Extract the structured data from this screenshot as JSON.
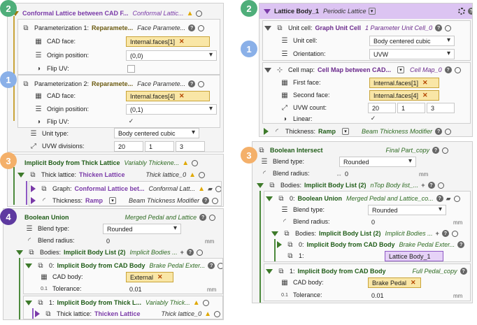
{
  "colors": {
    "badge_green": "#4fae7a",
    "badge_blue": "#8ab0e8",
    "badge_orange": "#f4b06a",
    "badge_purple": "#5e3aa0",
    "chip_gold": "#f9e6a6",
    "chip_purple": "#e6d2f7"
  },
  "badges": {
    "b2a": "2",
    "b1a": "1",
    "b3a": "3",
    "b4": "4",
    "b2b": "2",
    "b1b": "1",
    "b3b": "3"
  },
  "lattice_panel": {
    "title": "Conformal Lattice between CAD F...",
    "title_type": "Conformal Lattic...",
    "param1": {
      "title": "Parameterization 1:",
      "name": "Reparamete...",
      "type": "Face Paramete...",
      "cad_face_label": "CAD face:",
      "cad_face_value": "Internal.faces[1]",
      "origin_label": "Origin position:",
      "origin_value": "(0,0)",
      "flip_label": "Flip UV:"
    },
    "param2": {
      "title": "Parameterization 2:",
      "name": "Reparamete...",
      "type": "Face Paramete...",
      "cad_face_label": "CAD face:",
      "cad_face_value": "Internal.faces[4]",
      "origin_label": "Origin position:",
      "origin_value": "(0,1)",
      "flip_label": "Flip UV:",
      "flip_check": "✓"
    },
    "unit_type_label": "Unit type:",
    "unit_type_value": "Body centered cubic",
    "uvw_label": "UVW divisions:",
    "uvw_values": [
      "20",
      "1",
      "3"
    ]
  },
  "thick_panel": {
    "title": "Implicit Body from Thick Lattice",
    "title_type": "Variably Thickene...",
    "thick_label": "Thick lattice:",
    "thick_name": "Thicken Lattice",
    "thick_type": "Thick lattice_0",
    "graph_label": "Graph:",
    "graph_name": "Conformal Lattice bet...",
    "graph_type": "Conformal Latt...",
    "thickness_label": "Thickness:",
    "thickness_name": "Ramp",
    "thickness_type": "Beam Thickness Modifier"
  },
  "union_panel": {
    "title": "Boolean Union",
    "title_type": "Merged Pedal and Lattice",
    "blend_type_label": "Blend type:",
    "blend_type_value": "Rounded",
    "blend_radius_label": "Blend radius:",
    "blend_radius_value": "0",
    "unit": "mm",
    "bodies_label": "Bodies:",
    "bodies_name": "Implicit Body List (2)",
    "bodies_type": "Implicit Bodies ...",
    "item0_label": "0:",
    "item0_name": "Implicit Body from CAD Body",
    "item0_type": "Brake Pedal Exter...",
    "cad_body_label": "CAD body:",
    "cad_body_value": "External",
    "tolerance_label": "Tolerance:",
    "tolerance_value": "0.01",
    "item1_label": "1:",
    "item1_name": "Implicit Body from Thick L...",
    "item1_type": "Variably Thick...",
    "thick_label": "Thick lattice:",
    "thick_name": "Thicken Lattice",
    "thick_type": "Thick lattice_0"
  },
  "body_panel": {
    "title": "Lattice Body_1",
    "title_type": "Periodic Lattice",
    "unit_cell_label": "Unit cell:",
    "unit_cell_name": "Graph Unit Cell",
    "unit_cell_type": "1 Parameter Unit Cell_0",
    "unit_cell_field_label": "Unit cell:",
    "unit_cell_field_value": "Body centered cubic",
    "orientation_label": "Orientation:",
    "orientation_value": "UVW",
    "cell_map_label": "Cell map:",
    "cell_map_name": "Cell Map between CAD...",
    "cell_map_type": "Cell Map_0",
    "first_face_label": "First face:",
    "first_face_value": "Internal.faces[1]",
    "second_face_label": "Second face:",
    "second_face_value": "Internal.faces[4]",
    "uvw_label": "UVW count:",
    "uvw_values": [
      "20",
      "1",
      "3"
    ],
    "linear_label": "Linear:",
    "linear_check": "✓",
    "thickness_label": "Thickness:",
    "thickness_name": "Ramp",
    "thickness_type": "Beam Thickness Modifier"
  },
  "intersect_panel": {
    "title": "Boolean Intersect",
    "title_type": "Final Part_copy",
    "blend_type_label": "Blend type:",
    "blend_type_value": "Rounded",
    "blend_radius_label": "Blend radius:",
    "blend_radius_value": "0",
    "unit": "mm",
    "bodies_label": "Bodies:",
    "bodies_name": "Implicit Body List (2)",
    "bodies_type": "nTop Body list_...",
    "u0_label": "0:",
    "u0_name": "Boolean Union",
    "u0_type": "Merged Pedal and Lattice_co...",
    "u0_blend_type_label": "Blend type:",
    "u0_blend_type_value": "Rounded",
    "u0_blend_radius_label": "Blend radius:",
    "u0_blend_radius_value": "0",
    "u0_bodies_label": "Bodies:",
    "u0_bodies_name": "Implicit Body List (2)",
    "u0_bodies_type": "Implicit Bodies ...",
    "u0_item0_label": "0:",
    "u0_item0_name": "Implicit Body from CAD Body",
    "u0_item0_type": "Brake Pedal Exter...",
    "u0_item1_label": "1:",
    "u0_item1_value": "Lattice Body_1",
    "i1_label": "1:",
    "i1_name": "Implicit Body from CAD Body",
    "i1_type": "Full Pedal_copy",
    "cad_body_label": "CAD body:",
    "cad_body_value": "Brake Pedal",
    "tolerance_label": "Tolerance:",
    "tolerance_value": "0.01"
  }
}
